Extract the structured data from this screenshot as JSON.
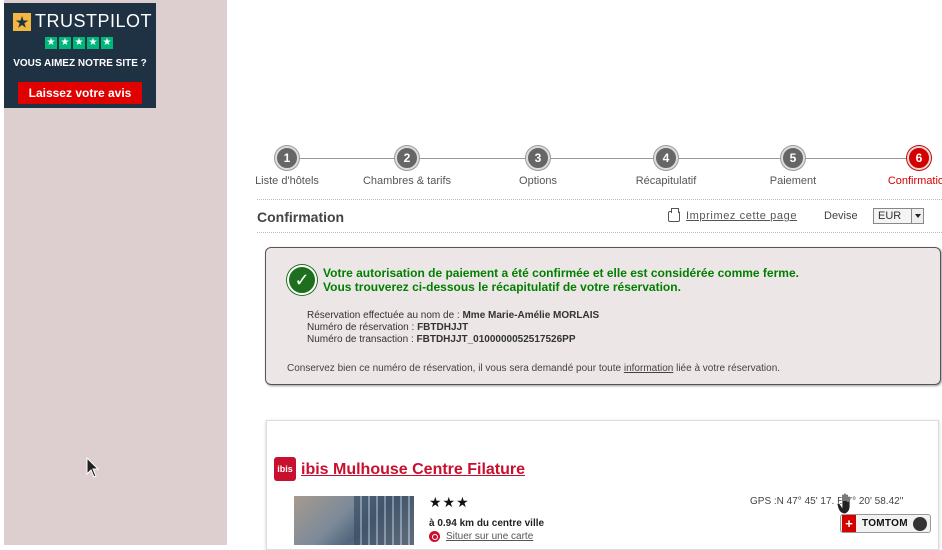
{
  "trustpilot": {
    "brand": "TRUSTPILOT",
    "question": "VOUS AIMEZ NOTRE SITE ?",
    "button_label": "Laissez votre avis"
  },
  "steps": [
    {
      "num": "1",
      "label": "Liste d'hôtels"
    },
    {
      "num": "2",
      "label": "Chambres & tarifs"
    },
    {
      "num": "3",
      "label": "Options"
    },
    {
      "num": "4",
      "label": "Récapitulatif"
    },
    {
      "num": "5",
      "label": "Paiement"
    },
    {
      "num": "6",
      "label": "Confirmation"
    }
  ],
  "header": {
    "title": "Confirmation",
    "print_label": "Imprimez cette page",
    "devise_label": "Devise",
    "currency": "EUR"
  },
  "confirmation": {
    "line1": "Votre autorisation de paiement a été confirmée et elle est considérée comme ferme.",
    "line2": "Vous trouverez ci-dessous le récapitulatif de votre réservation.",
    "name_label": "Réservation effectuée au nom de : ",
    "name_value": "Mme Marie-Amélie MORLAIS",
    "resa_label": "Numéro de réservation : ",
    "resa_value": "FBTDHJJT",
    "trans_label": "Numéro de transaction : ",
    "trans_value": "FBTDHJJT_0100000052517526PP",
    "note_before": "Conservez bien ce numéro de réservation, il vous sera demandé pour toute ",
    "note_link": "information",
    "note_after": " liée à votre réservation."
  },
  "hotel": {
    "logo_text": "ibis",
    "name": "ibis Mulhouse Centre Filature",
    "stars": "★★★",
    "distance": "à 0.94 km du centre ville",
    "map_link": "Situer sur une carte",
    "gps": "GPS :N 47° 45' 17.     E 7° 20' 58.42\"",
    "tomtom_label": "TOMTOM"
  },
  "colors": {
    "accent_red": "#d40000",
    "success_green": "#008000",
    "sidebar_bg": "#ddcfcf"
  }
}
